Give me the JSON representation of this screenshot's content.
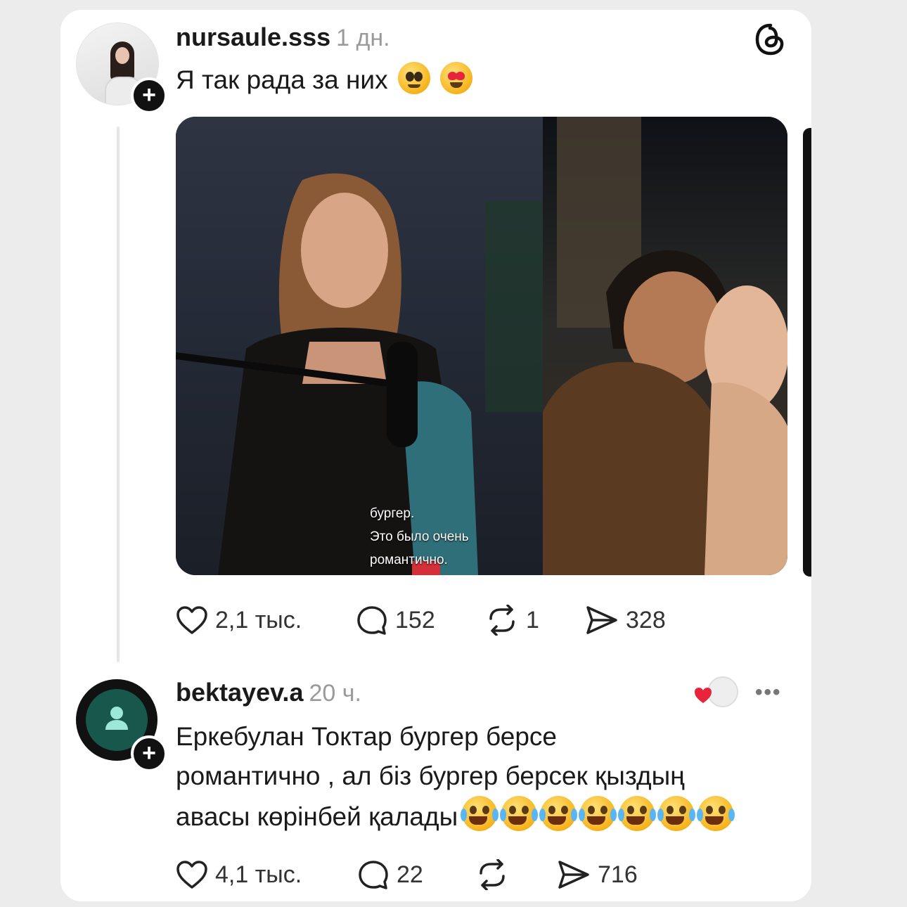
{
  "post": {
    "username": "nursaule.sss",
    "time": "1 дн.",
    "text": "Я так рада за них",
    "media": {
      "subtitle_line1": "бургер.",
      "subtitle_line2": "Это было очень романтично."
    },
    "stats": {
      "likes": "2,1 тыс.",
      "comments": "152",
      "reposts": "1",
      "shares": "328"
    }
  },
  "reply": {
    "username": "bektayev.a",
    "time": "20 ч.",
    "text_line1": "Еркебулан Токтар бургер берсе",
    "text_line2": "романтично , ал біз бургер берсек қыздың",
    "text_line3": "авасы көрінбей қалады",
    "stats": {
      "likes": "4,1 тыс.",
      "comments": "22",
      "shares": "716"
    }
  },
  "icons": {
    "app": "threads-icon",
    "like": "heart-icon",
    "comment": "comment-icon",
    "repost": "repost-icon",
    "share": "send-icon",
    "follow": "plus-icon",
    "more": "more-icon"
  },
  "colors": {
    "accent": "#17574c",
    "heart": "#e8243c"
  }
}
